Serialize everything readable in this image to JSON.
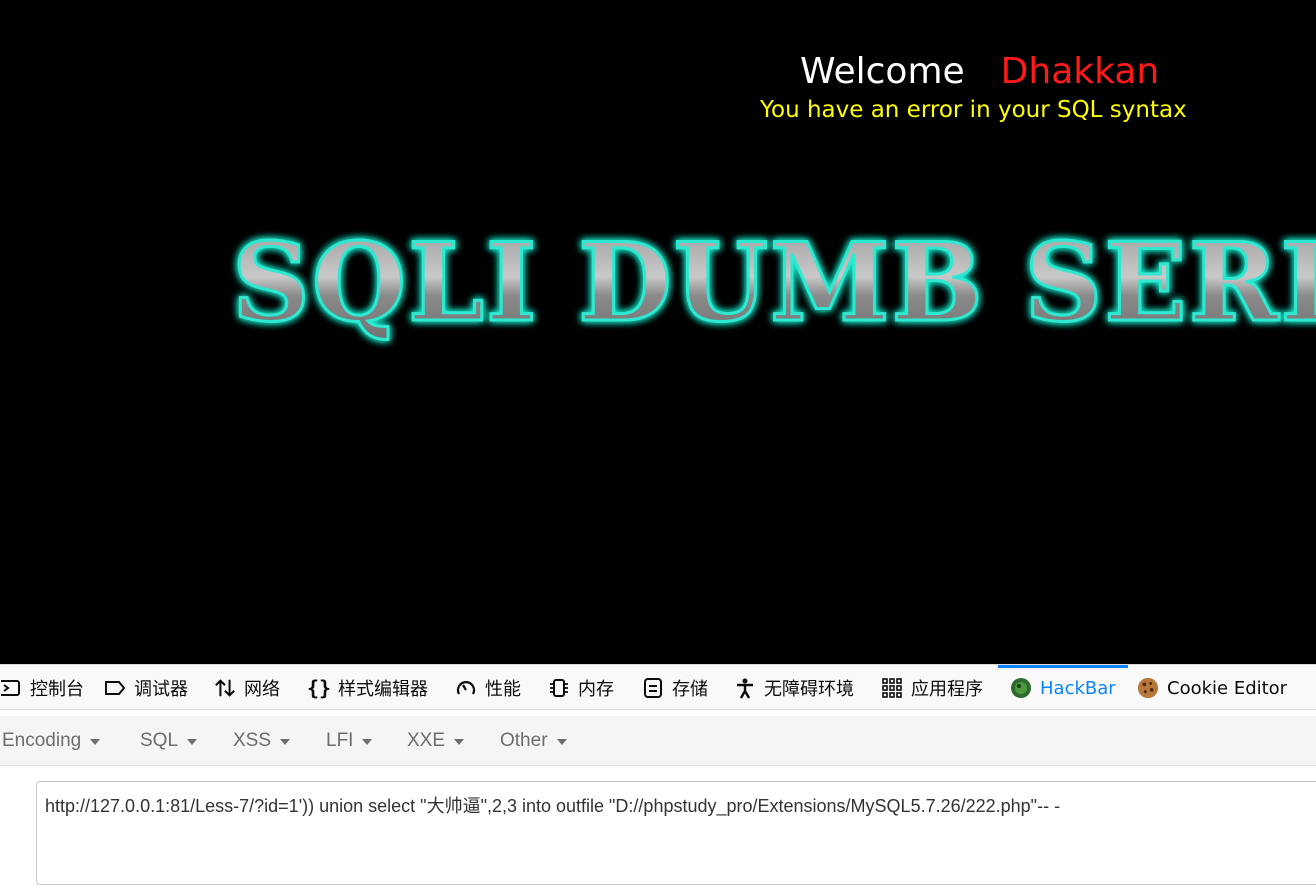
{
  "page": {
    "welcome_word": "Welcome",
    "welcome_name": "Dhakkan",
    "error_message": "You have an error in your SQL syntax",
    "banner_text": "SQLI DUMB SERIES"
  },
  "colors": {
    "welcome_word": "#ffffff",
    "welcome_name": "#ff1a1a",
    "error_message": "#ffff00",
    "banner_glow": "#19e6c8",
    "devtools_active": "#0a84ff"
  },
  "devtools": {
    "tabs": [
      {
        "label": "控制台",
        "icon": "console-icon"
      },
      {
        "label": "调试器",
        "icon": "debugger-icon"
      },
      {
        "label": "网络",
        "icon": "network-arrows-icon"
      },
      {
        "label": "样式编辑器",
        "icon": "braces-icon"
      },
      {
        "label": "性能",
        "icon": "gauge-icon"
      },
      {
        "label": "内存",
        "icon": "memory-chip-icon"
      },
      {
        "label": "存储",
        "icon": "storage-icon"
      },
      {
        "label": "无障碍环境",
        "icon": "accessibility-icon"
      },
      {
        "label": "应用程序",
        "icon": "grid-apps-icon"
      },
      {
        "label": "HackBar",
        "icon": "hackbar-icon",
        "active": true
      },
      {
        "label": "Cookie Editor",
        "icon": "cookie-icon"
      }
    ]
  },
  "hackbar": {
    "menus": [
      "Encoding",
      "SQL",
      "XSS",
      "LFI",
      "XXE",
      "Other"
    ],
    "url": "http://127.0.0.1:81/Less-7/?id=1')) union select \"大帅逼\",2,3 into outfile \"D://phpstudy_pro/Extensions/MySQL5.7.26/222.php\"-- -"
  }
}
